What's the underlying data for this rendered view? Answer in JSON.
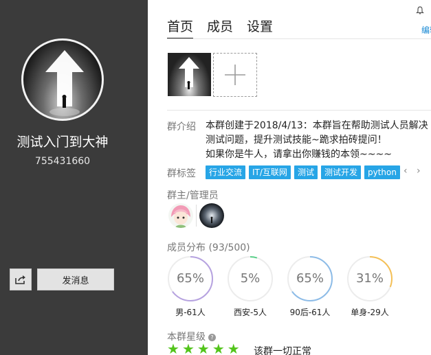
{
  "group": {
    "name": "测试入门到大神",
    "id": "755431660"
  },
  "actions": {
    "send_message": "发消息"
  },
  "tabs": [
    {
      "label": "首页",
      "active": true
    },
    {
      "label": "成员",
      "active": false
    },
    {
      "label": "设置",
      "active": false
    }
  ],
  "edit_label": "编辑",
  "intro": {
    "label": "群介绍",
    "text": "本群创建于2018/4/13：本群旨在帮助测试人员解决测试问题，提升测试技能~跪求拍砖提问！\n如果你是牛人，请拿出你赚钱的本领~~~~"
  },
  "tags": {
    "label": "群标签",
    "items": [
      "行业交流",
      "IT/互联网",
      "测试",
      "测试开发",
      "python"
    ],
    "prev": "‹",
    "next": "›"
  },
  "admins": {
    "label": "群主/管理员"
  },
  "distribution": {
    "label": "成员分布",
    "count": "(93/500)",
    "items": [
      {
        "percent": "65%",
        "value": 0.65,
        "caption": "男-61人",
        "color": "#b6a2e0"
      },
      {
        "percent": "5%",
        "value": 0.05,
        "caption": "西安-5人",
        "color": "#5bd08a"
      },
      {
        "percent": "65%",
        "value": 0.65,
        "caption": "90后-61人",
        "color": "#8dbce8"
      },
      {
        "percent": "31%",
        "value": 0.31,
        "caption": "单身-29人",
        "color": "#f5c056"
      }
    ]
  },
  "level": {
    "label": "本群星级",
    "stars": 5,
    "status": "该群一切正常"
  },
  "icons": {
    "share": "share-icon",
    "add": "plus-icon",
    "help": "question-icon",
    "star": "star-icon",
    "top": "bell-icon"
  },
  "colors": {
    "left_panel": "#3b3b3b",
    "tag_bg": "#27a5e6",
    "star": "#52c41a",
    "link": "#1a8ad4"
  }
}
